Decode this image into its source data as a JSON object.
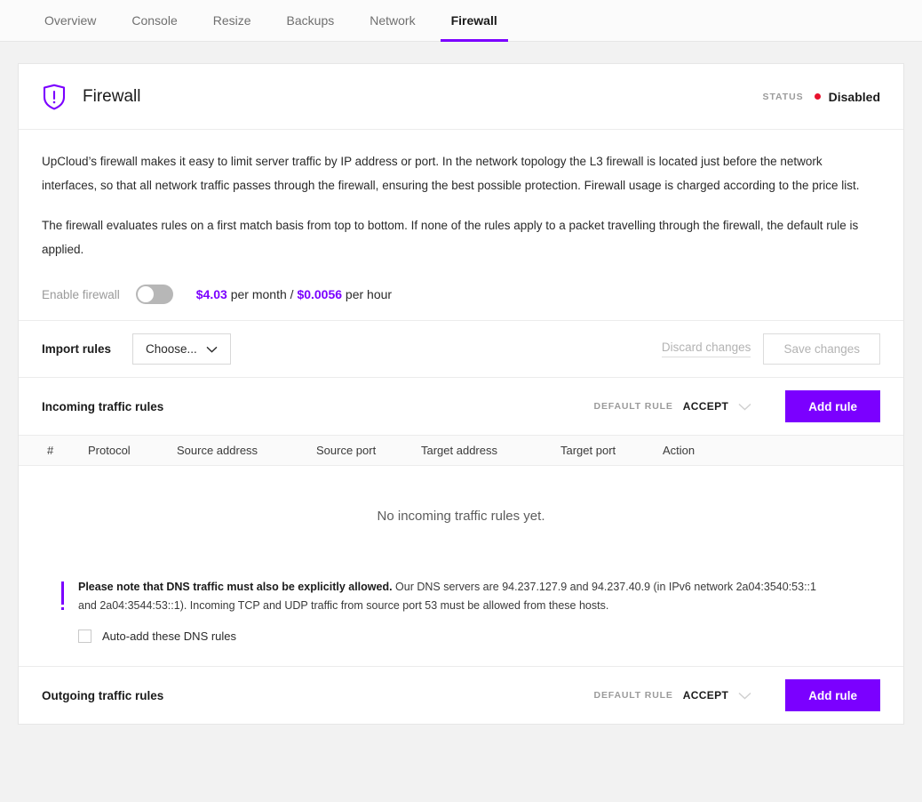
{
  "tabs": [
    {
      "label": "Overview",
      "active": false
    },
    {
      "label": "Console",
      "active": false
    },
    {
      "label": "Resize",
      "active": false
    },
    {
      "label": "Backups",
      "active": false
    },
    {
      "label": "Network",
      "active": false
    },
    {
      "label": "Firewall",
      "active": true
    }
  ],
  "card": {
    "title": "Firewall",
    "icon": "shield-alert-icon",
    "status_label": "STATUS",
    "status_value": "Disabled",
    "status_color": "#e8112d"
  },
  "description": {
    "paragraph1": "UpCloud’s firewall makes it easy to limit server traffic by IP address or port. In the network topology the L3 firewall is located just before the network interfaces, so that all network traffic passes through the firewall, ensuring the best possible protection. Firewall usage is charged according to the price list.",
    "paragraph2": "The firewall evaluates rules on a first match basis from top to bottom. If none of the rules apply to a packet travelling through the firewall, the default rule is applied."
  },
  "enable": {
    "label": "Enable firewall",
    "toggle_state": "off",
    "price_month": "$4.03",
    "price_month_suffix": " per month / ",
    "price_hour": "$0.0056",
    "price_hour_suffix": " per hour"
  },
  "import": {
    "label": "Import rules",
    "choose_label": "Choose...",
    "discard_label": "Discard changes",
    "save_label": "Save changes"
  },
  "incoming": {
    "title": "Incoming traffic rules",
    "default_rule_label": "DEFAULT RULE",
    "default_rule_value": "ACCEPT",
    "add_rule_label": "Add rule",
    "columns": [
      "#",
      "Protocol",
      "Source address",
      "Source port",
      "Target address",
      "Target port",
      "Action"
    ],
    "rows": [],
    "empty_message": "No incoming traffic rules yet."
  },
  "dns_note": {
    "bold_prefix": "Please note that DNS traffic must also be explicitly allowed.",
    "body": " Our DNS servers are 94.237.127.9 and 94.237.40.9 (in IPv6 network 2a04:3540:53::1 and 2a04:3544:53::1). Incoming TCP and UDP traffic from source port 53 must be allowed from these hosts.",
    "checkbox_label": "Auto-add these DNS rules",
    "checkbox_checked": false
  },
  "outgoing": {
    "title": "Outgoing traffic rules",
    "default_rule_label": "DEFAULT RULE",
    "default_rule_value": "ACCEPT",
    "add_rule_label": "Add rule"
  },
  "colors": {
    "accent": "#7b00ff",
    "status_red": "#e8112d"
  }
}
